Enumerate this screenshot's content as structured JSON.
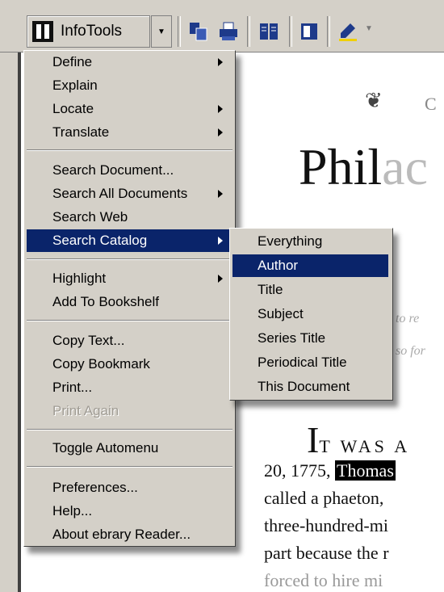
{
  "toolbar": {
    "infotools_label": "InfoTools"
  },
  "menu": {
    "items": [
      {
        "label": "Define",
        "submenu": true
      },
      {
        "label": "Explain",
        "submenu": false
      },
      {
        "label": "Locate",
        "submenu": true
      },
      {
        "label": "Translate",
        "submenu": true
      },
      {
        "label": "Search Document...",
        "submenu": false
      },
      {
        "label": "Search All Documents",
        "submenu": true
      },
      {
        "label": "Search Web",
        "submenu": false
      },
      {
        "label": "Search Catalog",
        "submenu": true,
        "selected": true
      },
      {
        "label": "Highlight",
        "submenu": true
      },
      {
        "label": "Add To Bookshelf",
        "submenu": false
      },
      {
        "label": "Copy Text...",
        "submenu": false
      },
      {
        "label": "Copy Bookmark",
        "submenu": false
      },
      {
        "label": "Print...",
        "submenu": false
      },
      {
        "label": "Print Again",
        "submenu": false,
        "disabled": true
      },
      {
        "label": "Toggle Automenu",
        "submenu": false
      },
      {
        "label": "Preferences...",
        "submenu": false
      },
      {
        "label": "Help...",
        "submenu": false
      },
      {
        "label": "About ebrary Reader...",
        "submenu": false
      }
    ]
  },
  "submenu": {
    "items": [
      {
        "label": "Everything"
      },
      {
        "label": "Author",
        "selected": true
      },
      {
        "label": "Title"
      },
      {
        "label": "Subject"
      },
      {
        "label": "Series Title"
      },
      {
        "label": "Periodical Title"
      },
      {
        "label": "This Document"
      }
    ]
  },
  "document": {
    "fleuron": "❦",
    "small_caps_fragment": "C",
    "title_visible": "Phil",
    "title_faded": "ac",
    "italic_line_1": "to re",
    "italic_line_2": "so for",
    "dropcap": "I",
    "dropcap_rest": "T WAS A",
    "dropcap_faded": " ",
    "line1_prefix": "20, 1775, ",
    "line1_highlight": "Thomas",
    "line2_visible": "called a phaeton,",
    "line3_visible": "three-hundred-mi",
    "line4_visible": "part because the r",
    "line5_visible": "forced to hire mi"
  },
  "colors": {
    "menu_bg": "#d4d0c8",
    "selection": "#0a246a",
    "disabled_text": "#a09c94"
  }
}
